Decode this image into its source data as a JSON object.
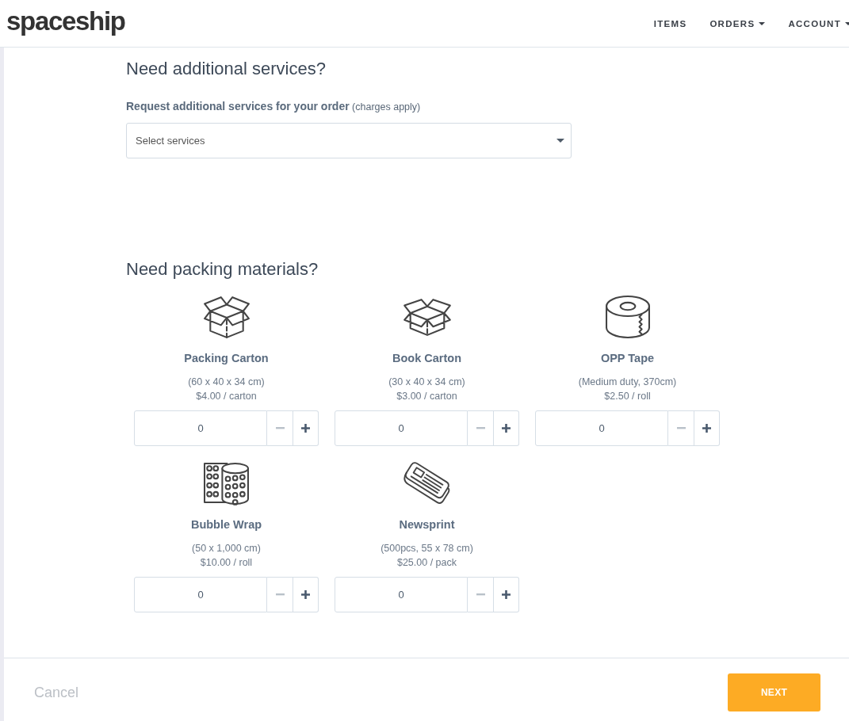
{
  "header": {
    "logo": "spaceship",
    "nav": [
      {
        "label": "ITEMS",
        "dropdown": false
      },
      {
        "label": "ORDERS",
        "dropdown": true
      },
      {
        "label": "ACCOUNT",
        "dropdown": true
      }
    ]
  },
  "services": {
    "title": "Need additional services?",
    "label": "**Request additional services for your order** (charges apply)",
    "select": {
      "placeholder": "Select services"
    }
  },
  "packing": {
    "title": "Need packing materials?",
    "items": [
      {
        "kind": "carton",
        "name": "Packing Carton",
        "size": "(60 x 40 x 34 cm)",
        "price": "$4.00 / carton",
        "quantity": "0",
        "minus_disabled": true
      },
      {
        "kind": "book",
        "name": "Book Carton",
        "size": "(30 x 40 x 34 cm)",
        "price": "$3.00 / carton",
        "quantity": "0",
        "minus_disabled": true
      },
      {
        "kind": "tape",
        "name": "OPP Tape",
        "size": "(Medium duty, 370cm)",
        "price": "$2.50 / roll",
        "quantity": "0",
        "minus_disabled": true
      },
      {
        "kind": "bubble",
        "name": "Bubble Wrap",
        "size": "(50 x 1,000 cm)",
        "price": "$10.00 / roll",
        "quantity": "0",
        "minus_disabled": true
      },
      {
        "kind": "newsprint",
        "name": "Newsprint",
        "size": "(500pcs, 55 x 78 cm)",
        "price": "$25.00 / pack",
        "quantity": "0",
        "minus_disabled": true
      }
    ]
  },
  "footer": {
    "cancel": "Cancel",
    "next": "NEXT"
  }
}
